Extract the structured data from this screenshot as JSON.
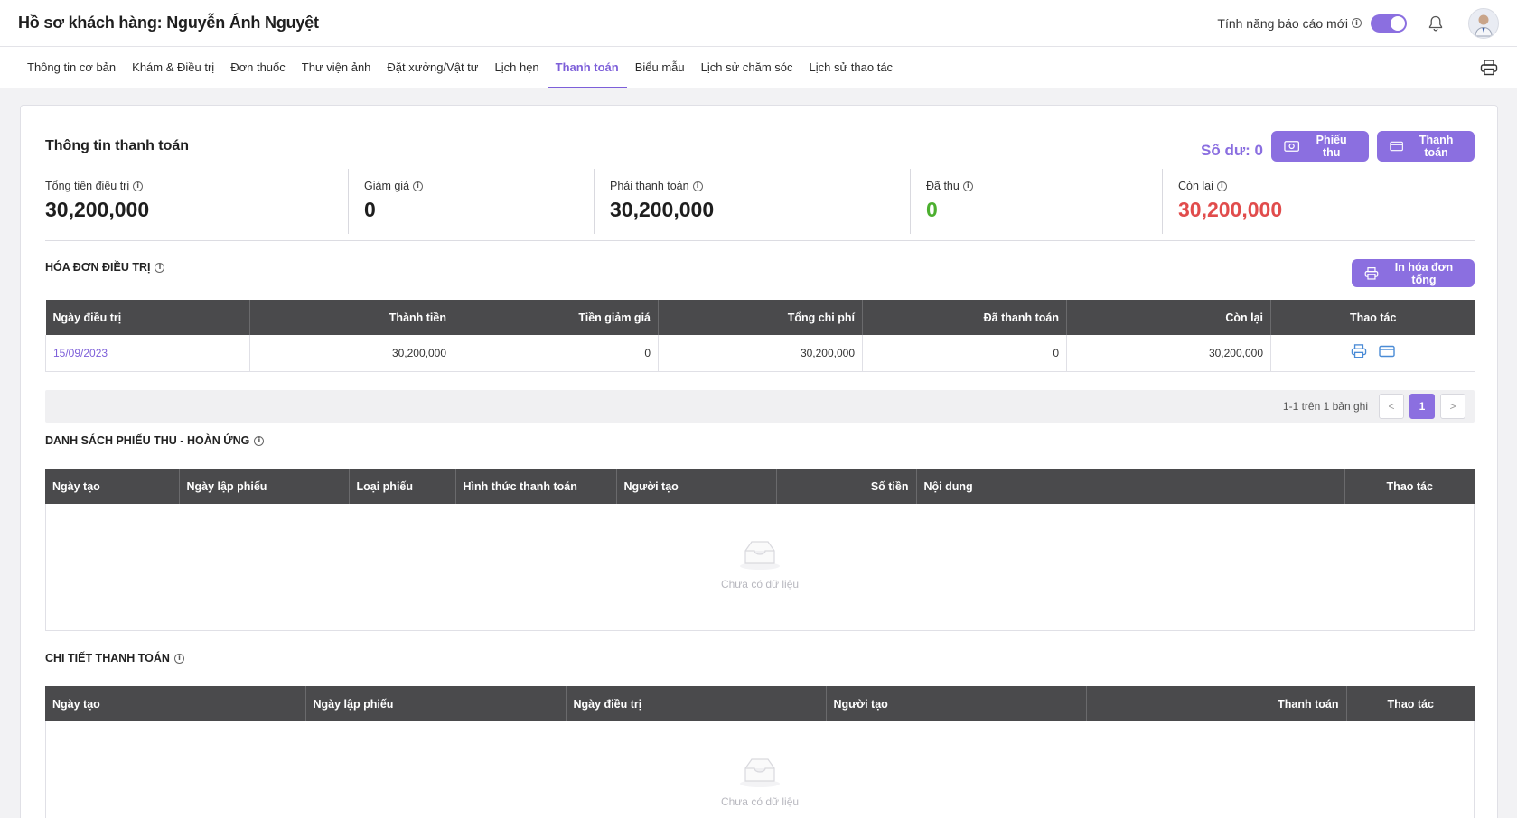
{
  "header": {
    "title": "Hồ sơ khách hàng: Nguyễn Ánh Nguyệt",
    "feature_label": "Tính năng báo cáo mới",
    "feature_enabled": true
  },
  "tabs": [
    {
      "label": "Thông tin cơ bản",
      "active": false
    },
    {
      "label": "Khám & Điều trị",
      "active": false
    },
    {
      "label": "Đơn thuốc",
      "active": false
    },
    {
      "label": "Thư viện ảnh",
      "active": false
    },
    {
      "label": "Đặt xưởng/Vật tư",
      "active": false
    },
    {
      "label": "Lịch hẹn",
      "active": false
    },
    {
      "label": "Thanh toán",
      "active": true
    },
    {
      "label": "Biểu mẫu",
      "active": false
    },
    {
      "label": "Lịch sử chăm sóc",
      "active": false
    },
    {
      "label": "Lịch sử thao tác",
      "active": false
    }
  ],
  "payment": {
    "title": "Thông tin thanh toán",
    "balance": "Số dư: 0",
    "receipt_button": "Phiếu thu",
    "pay_button": "Thanh toán",
    "stats": [
      {
        "label": "Tổng tiền điều trị",
        "value": "30,200,000"
      },
      {
        "label": "Giảm giá",
        "value": "0"
      },
      {
        "label": "Phải thanh toán",
        "value": "30,200,000"
      },
      {
        "label": "Đã thu",
        "value": "0"
      },
      {
        "label": "Còn lại",
        "value": "30,200,000"
      }
    ]
  },
  "invoices": {
    "title": "HÓA ĐƠN ĐIỀU TRỊ",
    "print_button": "In hóa đơn tổng",
    "columns": [
      "Ngày điều trị",
      "Thành tiền",
      "Tiền giảm giá",
      "Tổng chi phí",
      "Đã thanh toán",
      "Còn lại",
      "Thao tác"
    ],
    "rows": [
      {
        "date": "15/09/2023",
        "amount": "30,200,000",
        "discount": "0",
        "total": "30,200,000",
        "paid": "0",
        "remaining": "30,200,000"
      }
    ],
    "pagination": {
      "summary": "1-1 trên 1 bản ghi",
      "current_page": "1",
      "prev": "<",
      "next": ">"
    }
  },
  "receipts": {
    "title": "DANH SÁCH PHIẾU THU - HOÀN ỨNG",
    "columns": [
      "Ngày tạo",
      "Ngày lập phiếu",
      "Loại phiếu",
      "Hình thức thanh toán",
      "Người tạo",
      "Số tiền",
      "Nội dung",
      "Thao tác"
    ],
    "empty_text": "Chưa có dữ liệu"
  },
  "details": {
    "title": "CHI TIẾT THANH TOÁN",
    "columns": [
      "Ngày tạo",
      "Ngày lập phiếu",
      "Ngày điều trị",
      "Người tạo",
      "Thanh toán",
      "Thao tác"
    ],
    "empty_text": "Chưa có dữ liệu"
  },
  "colors": {
    "accent": "#8b6fe0",
    "green": "#4caf2f",
    "red": "#e14c4c",
    "table_header": "#4a4a4c"
  }
}
